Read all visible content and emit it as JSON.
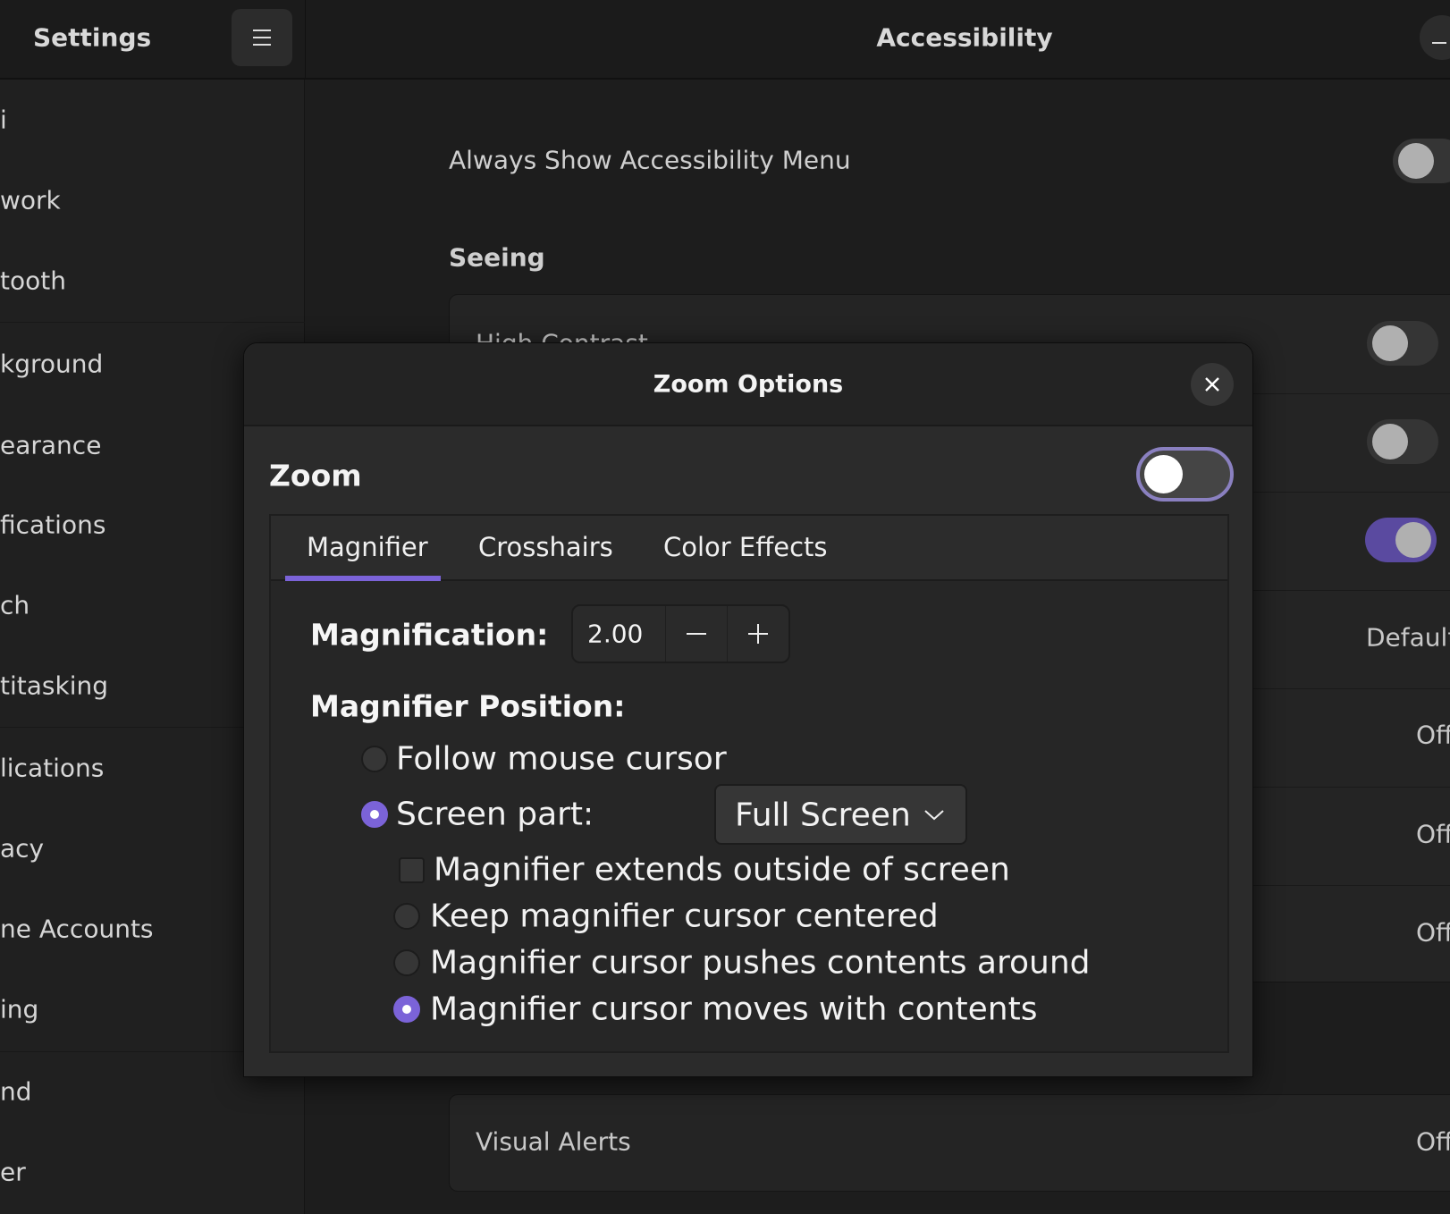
{
  "header": {
    "app_title": "Settings",
    "page_title": "Accessibility"
  },
  "sidebar": {
    "items": [
      "i",
      "work",
      "tooth",
      "kground",
      "earance",
      "fications",
      "ch",
      "titasking",
      "lications",
      "acy",
      "ne Accounts",
      "ing",
      "nd",
      "er"
    ]
  },
  "main": {
    "always_show_menu": {
      "label": "Always Show Accessibility Menu",
      "on": false
    },
    "section_seeing": "Seeing",
    "rows": [
      {
        "label": "High Contrast",
        "type": "toggle",
        "on": false
      },
      {
        "type": "toggle",
        "on": false
      },
      {
        "type": "toggle",
        "on": true
      },
      {
        "value": "Default"
      },
      {
        "value": "Off"
      },
      {
        "value": "Off"
      },
      {
        "value": "Off"
      }
    ],
    "visual_alerts": {
      "label": "Visual Alerts",
      "value": "Off"
    }
  },
  "dialog": {
    "title": "Zoom Options",
    "zoom_label": "Zoom",
    "zoom_on": false,
    "tabs": [
      "Magnifier",
      "Crosshairs",
      "Color Effects"
    ],
    "active_tab": "Magnifier",
    "magnification_label": "Magnification:",
    "magnification_value": "2.00",
    "position_label": "Magnifier Position:",
    "follow_mouse": "Follow mouse cursor",
    "screen_part": "Screen part:",
    "screen_part_value": "Full Screen",
    "extends_outside": "Magnifier extends outside of screen",
    "keep_centered": "Keep magnifier cursor centered",
    "pushes": "Magnifier cursor pushes contents around",
    "moves": "Magnifier cursor moves with contents",
    "accent": "#7b63d8"
  }
}
